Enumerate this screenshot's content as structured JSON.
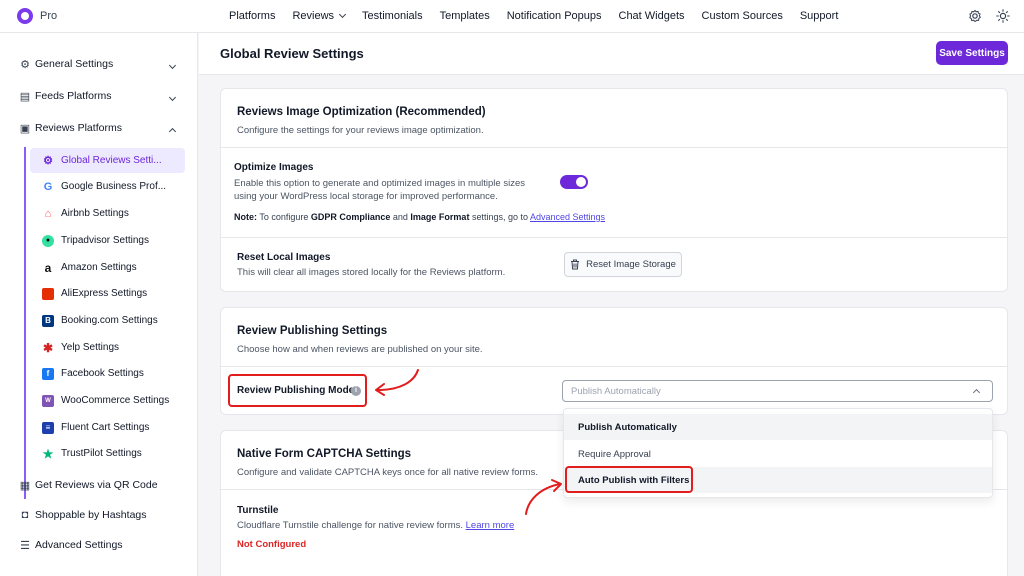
{
  "app": {
    "name": "Pro"
  },
  "nav": {
    "items": [
      {
        "label": "Platforms"
      },
      {
        "label": "Reviews",
        "has_caret": true
      },
      {
        "label": "Testimonials"
      },
      {
        "label": "Templates"
      },
      {
        "label": "Notification Popups"
      },
      {
        "label": "Chat Widgets"
      },
      {
        "label": "Custom Sources"
      },
      {
        "label": "Support"
      }
    ]
  },
  "sidebar": {
    "general": "General Settings",
    "feeds": "Feeds Platforms",
    "reviews": "Reviews Platforms",
    "items": [
      {
        "label": "Global Reviews Setti...",
        "icon": "gear-icon",
        "active": true
      },
      {
        "label": "Google Business Prof...",
        "icon": "google-icon"
      },
      {
        "label": "Airbnb Settings",
        "icon": "airbnb-icon"
      },
      {
        "label": "Tripadvisor Settings",
        "icon": "tripadvisor-icon"
      },
      {
        "label": "Amazon Settings",
        "icon": "amazon-icon"
      },
      {
        "label": "AliExpress Settings",
        "icon": "aliexpress-icon"
      },
      {
        "label": "Booking.com Settings",
        "icon": "booking-icon"
      },
      {
        "label": "Yelp Settings",
        "icon": "yelp-icon"
      },
      {
        "label": "Facebook Settings",
        "icon": "facebook-icon"
      },
      {
        "label": "WooCommerce Settings",
        "icon": "woocommerce-icon"
      },
      {
        "label": "Fluent Cart Settings",
        "icon": "fluentcart-icon"
      },
      {
        "label": "TrustPilot Settings",
        "icon": "trustpilot-icon"
      }
    ],
    "qr": "Get Reviews via QR Code",
    "shoppable": "Shoppable by Hashtags",
    "advanced": "Advanced Settings"
  },
  "header": {
    "title": "Global Review Settings",
    "save_label": "Save Settings"
  },
  "image_opt": {
    "title": "Reviews Image Optimization (Recommended)",
    "desc": "Configure the settings for your reviews image optimization.",
    "optimize_title": "Optimize Images",
    "optimize_desc1": "Enable this option to generate and optimized images in multiple sizes",
    "optimize_desc2": "using your WordPress local storage for improved performance.",
    "toggle_on": true,
    "note_prefix": "Note:",
    "note_text1": " To configure ",
    "note_gdpr": "GDPR Compliance",
    "note_and": " and ",
    "note_format": "Image Format",
    "note_text2": " settings, go to ",
    "note_link": "Advanced Settings",
    "reset_title": "Reset Local Images",
    "reset_desc": "This will clear all images stored locally for the Reviews platform.",
    "reset_button": "Reset Image Storage"
  },
  "publishing": {
    "title": "Review Publishing Settings",
    "desc": "Choose how and when reviews are published on your site.",
    "mode_label": "Review Publishing Mode",
    "selected": "Publish Automatically",
    "options": [
      "Publish Automatically",
      "Require Approval",
      "Auto Publish with Filters"
    ]
  },
  "captcha": {
    "title": "Native Form CAPTCHA Settings",
    "desc": "Configure and validate CAPTCHA keys once for all native review forms.",
    "turnstile_title": "Turnstile",
    "turnstile_desc": "Cloudflare Turnstile challenge for native review forms.",
    "learn_more": "Learn more",
    "status": "Not Configured"
  },
  "colors": {
    "accent": "#6d28d9",
    "annotation": "#e11d1d",
    "error": "#dc2626"
  }
}
